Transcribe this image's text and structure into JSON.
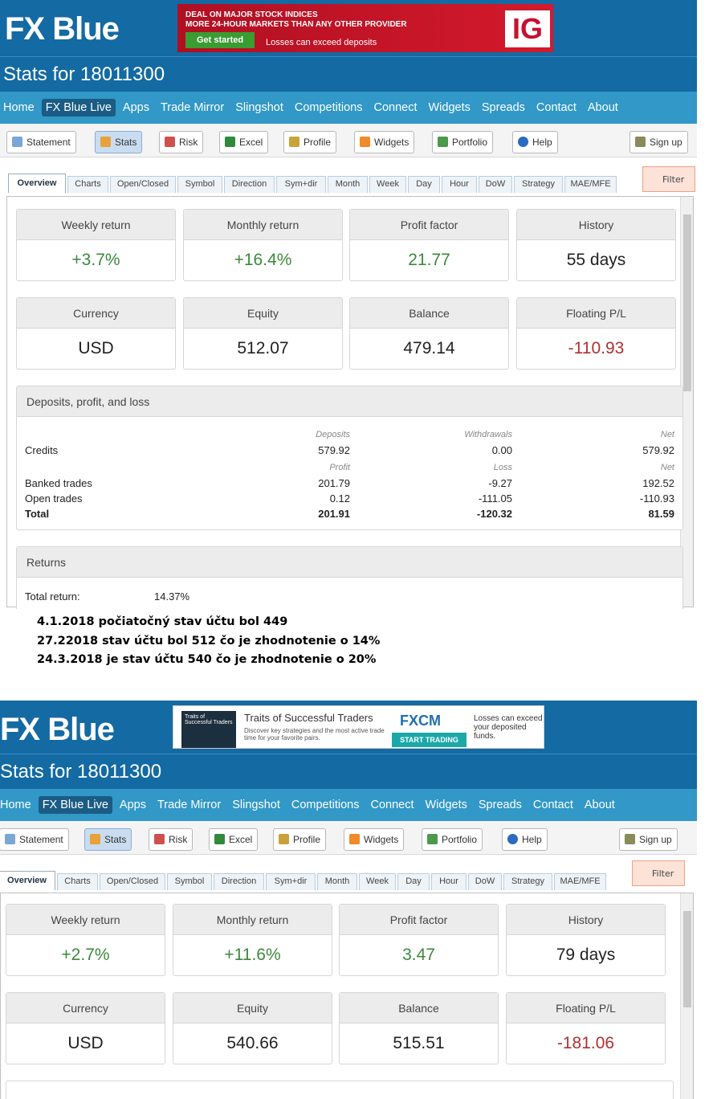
{
  "shot1": {
    "brand": "FX Blue",
    "ad": {
      "line1": "DEAL ON MAJOR STOCK INDICES",
      "line2": "MORE 24-HOUR MARKETS THAN ANY OTHER PROVIDER",
      "cta": "Get started",
      "disclaimer": "Losses can exceed deposits",
      "logo": "IG"
    },
    "title": "Stats for 18011300",
    "nav": [
      "Home",
      "FX Blue Live",
      "Apps",
      "Trade Mirror",
      "Slingshot",
      "Competitions",
      "Connect",
      "Widgets",
      "Spreads",
      "Contact",
      "About"
    ],
    "toolbar": [
      "Statement",
      "Stats",
      "Risk",
      "Excel",
      "Profile",
      "Widgets",
      "Portfolio",
      "Help",
      "Sign up"
    ],
    "tabs": [
      "Overview",
      "Charts",
      "Open/Closed",
      "Symbol",
      "Direction",
      "Sym+dir",
      "Month",
      "Week",
      "Day",
      "Hour",
      "DoW",
      "Strategy",
      "MAE/MFE"
    ],
    "filter": "Filter",
    "cards": [
      {
        "label": "Weekly return",
        "value": "+3.7%"
      },
      {
        "label": "Monthly return",
        "value": "+16.4%"
      },
      {
        "label": "Profit factor",
        "value": "21.77"
      },
      {
        "label": "History",
        "value": "55 days"
      },
      {
        "label": "Currency",
        "value": "USD"
      },
      {
        "label": "Equity",
        "value": "512.07"
      },
      {
        "label": "Balance",
        "value": "479.14"
      },
      {
        "label": "Floating P/L",
        "value": "-110.93"
      }
    ],
    "dpl": {
      "title": "Deposits, profit, and loss",
      "h1": [
        "Deposits",
        "Withdrawals",
        "Net"
      ],
      "credits": [
        "Credits",
        "579.92",
        "0.00",
        "579.92"
      ],
      "h2": [
        "Profit",
        "Loss",
        "Net"
      ],
      "banked": [
        "Banked trades",
        "201.79",
        "-9.27",
        "192.52"
      ],
      "open": [
        "Open trades",
        "0.12",
        "-111.05",
        "-110.93"
      ],
      "total": [
        "Total",
        "201.91",
        "-120.32",
        "81.59"
      ]
    },
    "returns": {
      "title": "Returns",
      "label": "Total return:",
      "value": "14.37%"
    }
  },
  "notes": [
    "4.1.2018 počiatočný stav účtu bol 449",
    "27.22018 stav účtu bol 512 čo je zhodnotenie o 14%",
    "24.3.2018 je stav účtu 540 čo je zhodnotenie o 20%"
  ],
  "shot2": {
    "brand": "FX Blue",
    "ad": {
      "thumb": "Traits of Successful Traders",
      "headline": "Traits of Successful Traders",
      "sub": "Discover key strategies and the most active trade time for your favorite pairs.",
      "brand": "FXCM",
      "cta": "START TRADING",
      "disclaimer": "Losses can exceed your deposited funds."
    },
    "title": "Stats for 18011300",
    "nav": [
      "Home",
      "FX Blue Live",
      "Apps",
      "Trade Mirror",
      "Slingshot",
      "Competitions",
      "Connect",
      "Widgets",
      "Spreads",
      "Contact",
      "About"
    ],
    "toolbar": [
      "Statement",
      "Stats",
      "Risk",
      "Excel",
      "Profile",
      "Widgets",
      "Portfolio",
      "Help",
      "Sign up"
    ],
    "tabs": [
      "Overview",
      "Charts",
      "Open/Closed",
      "Symbol",
      "Direction",
      "Sym+dir",
      "Month",
      "Week",
      "Day",
      "Hour",
      "DoW",
      "Strategy",
      "MAE/MFE"
    ],
    "filter": "Filter",
    "cards": [
      {
        "label": "Weekly return",
        "value": "+2.7%"
      },
      {
        "label": "Monthly return",
        "value": "+11.6%"
      },
      {
        "label": "Profit factor",
        "value": "3.47"
      },
      {
        "label": "History",
        "value": "79 days"
      },
      {
        "label": "Currency",
        "value": "USD"
      },
      {
        "label": "Equity",
        "value": "540.66"
      },
      {
        "label": "Balance",
        "value": "515.51"
      },
      {
        "label": "Floating P/L",
        "value": "-181.06"
      }
    ]
  },
  "colors": {
    "header": "#146aa3",
    "nav": "#3198c8",
    "positive": "#3b8a3b",
    "negative": "#b03030"
  }
}
